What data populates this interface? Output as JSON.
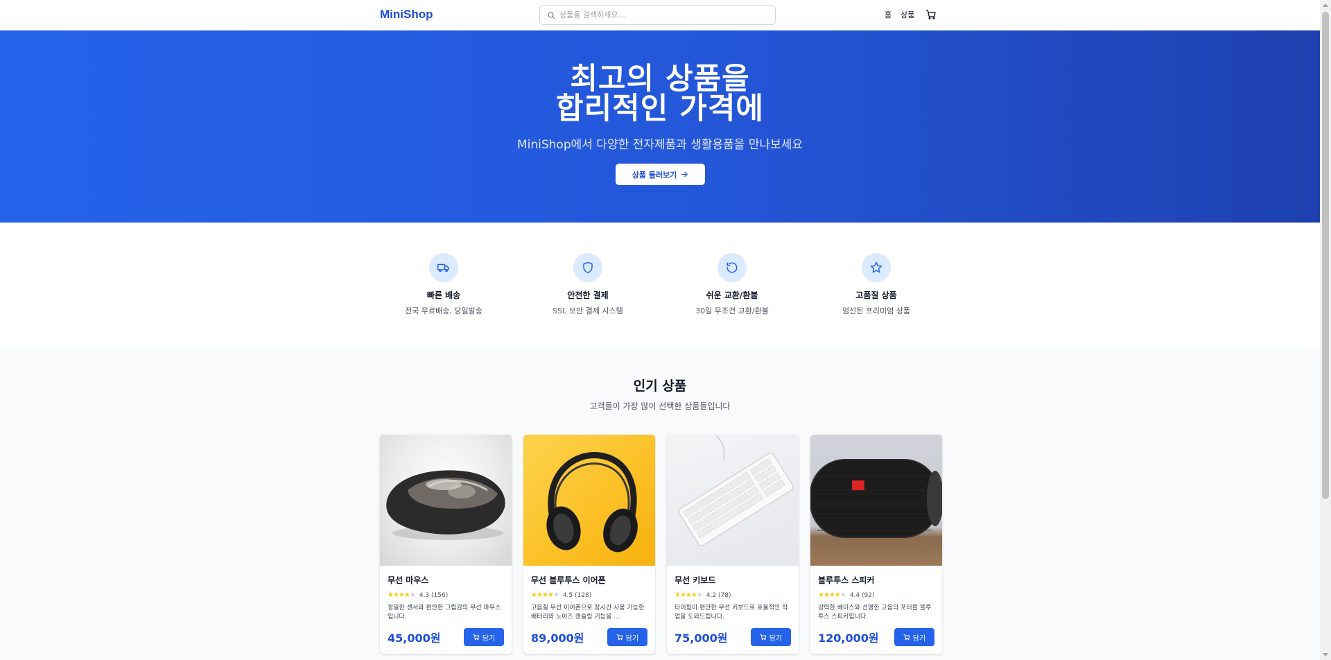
{
  "header": {
    "logo": "MiniShop",
    "search_placeholder": "상품을 검색하세요...",
    "nav_home": "홈",
    "nav_products": "상품"
  },
  "hero": {
    "title_line1": "최고의 상품을",
    "title_line2": "합리적인 가격에",
    "subtitle": "MiniShop에서 다양한 전자제품과 생활용품을 만나보세요",
    "cta_label": "상품 둘러보기"
  },
  "features": [
    {
      "icon": "truck-icon",
      "title": "빠른 배송",
      "desc": "전국 무료배송, 당일발송"
    },
    {
      "icon": "shield-icon",
      "title": "안전한 결제",
      "desc": "SSL 보안 결제 시스템"
    },
    {
      "icon": "refresh-icon",
      "title": "쉬운 교환/환불",
      "desc": "30일 무조건 교환/환불"
    },
    {
      "icon": "star-icon",
      "title": "고품질 상품",
      "desc": "엄선된 프리미엄 상품"
    }
  ],
  "popular": {
    "title": "인기 상품",
    "subtitle": "고객들이 가장 많이 선택한 상품들입니다",
    "add_label": "담기",
    "products": [
      {
        "name": "무선 마우스",
        "rating": "4.3",
        "reviews": "(156)",
        "stars_filled": 4,
        "desc": "정밀한 센서와 편안한 그립감의 무선 마우스입니다.",
        "price": "45,000원"
      },
      {
        "name": "무선 블루투스 이어폰",
        "rating": "4.5",
        "reviews": "(128)",
        "stars_filled": 4,
        "desc": "고음질 무선 이어폰으로 장시간 사용 가능한 배터리와 노이즈 캔슬링 기능을 ...",
        "price": "89,000원"
      },
      {
        "name": "무선 키보드",
        "rating": "4.2",
        "reviews": "(78)",
        "stars_filled": 4,
        "desc": "타이핑이 편안한 무선 키보드로 효율적인 작업을 도와드립니다.",
        "price": "75,000원"
      },
      {
        "name": "블루투스 스피커",
        "rating": "4.4",
        "reviews": "(92)",
        "stars_filled": 4,
        "desc": "강력한 베이스와 선명한 고음의 포터블 블루투스 스피커입니다.",
        "price": "120,000원"
      }
    ]
  },
  "colors": {
    "brand": "#1d4ed8",
    "button": "#2563eb",
    "hero_start": "#2563eb",
    "hero_end": "#1e40af",
    "star": "#facc15"
  }
}
